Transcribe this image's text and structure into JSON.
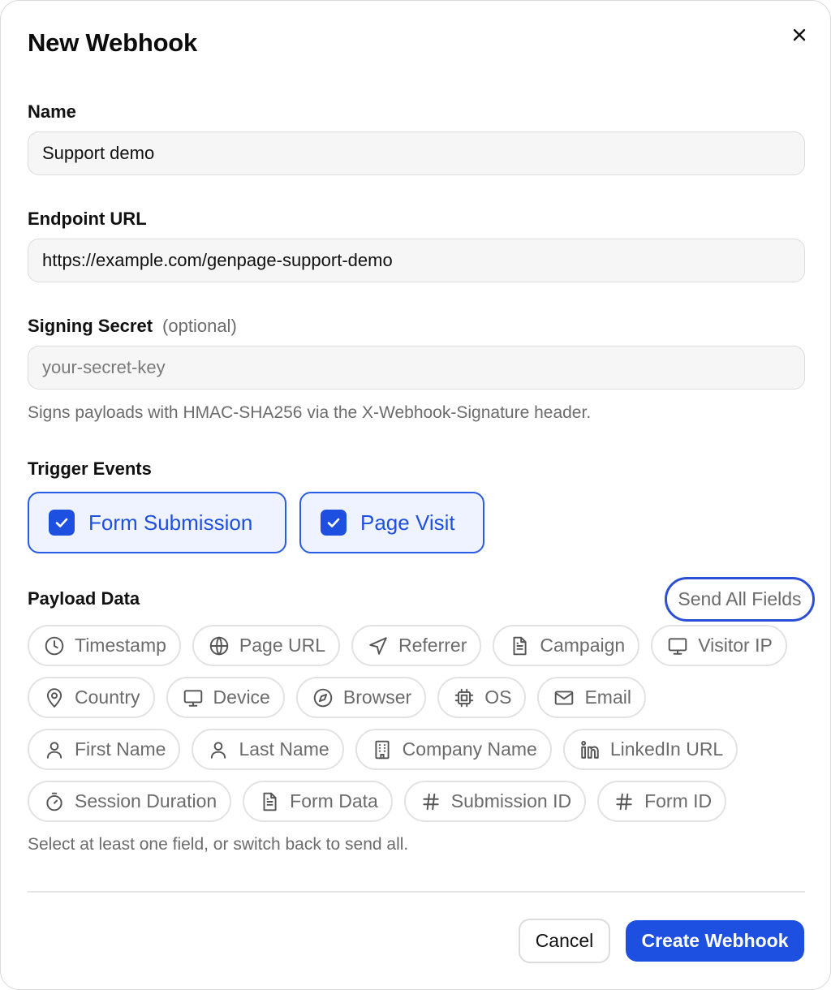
{
  "dialog": {
    "title": "New Webhook",
    "close_icon": "close-icon"
  },
  "name": {
    "label": "Name",
    "value": "Support demo"
  },
  "endpoint": {
    "label": "Endpoint URL",
    "value": "https://example.com/genpage-support-demo"
  },
  "secret": {
    "label": "Signing Secret",
    "optional": "(optional)",
    "value": "",
    "placeholder": "your-secret-key",
    "hint": "Signs payloads with HMAC-SHA256 via the X-Webhook-Signature header."
  },
  "triggers": {
    "label": "Trigger Events",
    "items": [
      {
        "label": "Form Submission",
        "checked": true
      },
      {
        "label": "Page Visit",
        "checked": true
      }
    ]
  },
  "payload": {
    "label": "Payload Data",
    "send_all_label": "Send All Fields",
    "fields": [
      {
        "label": "Timestamp",
        "icon": "clock-icon"
      },
      {
        "label": "Page URL",
        "icon": "globe-icon"
      },
      {
        "label": "Referrer",
        "icon": "navigation-arrow-icon"
      },
      {
        "label": "Campaign",
        "icon": "document-icon"
      },
      {
        "label": "Visitor IP",
        "icon": "monitor-icon"
      },
      {
        "label": "Country",
        "icon": "map-pin-icon"
      },
      {
        "label": "Device",
        "icon": "monitor-icon"
      },
      {
        "label": "Browser",
        "icon": "compass-icon"
      },
      {
        "label": "OS",
        "icon": "cpu-chip-icon"
      },
      {
        "label": "Email",
        "icon": "mail-icon"
      },
      {
        "label": "First Name",
        "icon": "user-icon"
      },
      {
        "label": "Last Name",
        "icon": "user-icon"
      },
      {
        "label": "Company Name",
        "icon": "building-icon"
      },
      {
        "label": "LinkedIn URL",
        "icon": "linkedin-icon"
      },
      {
        "label": "Session Duration",
        "icon": "stopwatch-icon"
      },
      {
        "label": "Form Data",
        "icon": "document-icon"
      },
      {
        "label": "Submission ID",
        "icon": "hash-icon"
      },
      {
        "label": "Form ID",
        "icon": "hash-icon"
      }
    ],
    "hint": "Select at least one field, or switch back to send all."
  },
  "footer": {
    "cancel_label": "Cancel",
    "create_label": "Create Webhook"
  },
  "colors": {
    "accent": "#1d4fe0",
    "accent_bg": "#eef3ff",
    "muted_text": "#6b6b6b"
  }
}
